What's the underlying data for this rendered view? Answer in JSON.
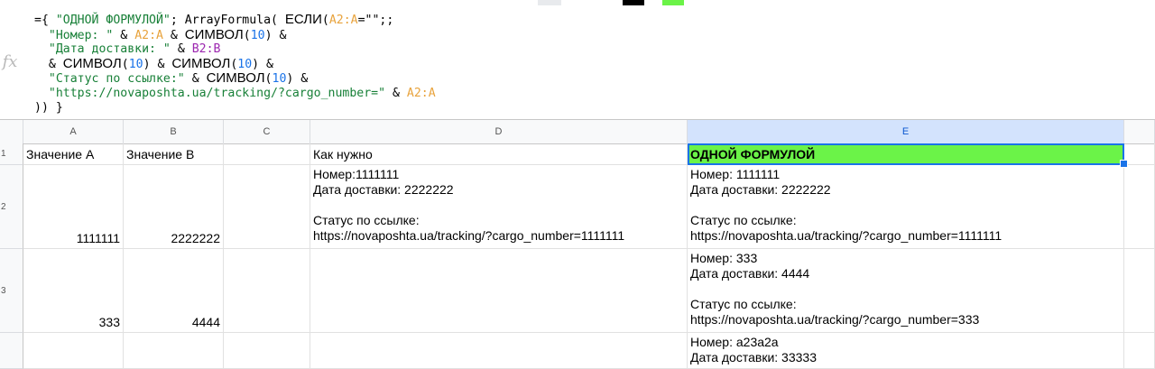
{
  "formula_bar": {
    "fx_label": "fx",
    "lines": [
      [
        {
          "t": "={ ",
          "c": "plain"
        },
        {
          "t": "\"ОДНОЙ ФОРМУЛОЙ\"",
          "c": "str"
        },
        {
          "t": "; ArrayFormula( ",
          "c": "plain"
        },
        {
          "t": "ЕСЛИ",
          "c": "fn"
        },
        {
          "t": "(",
          "c": "plain"
        },
        {
          "t": "A2:A",
          "c": "refA"
        },
        {
          "t": "=\"\";;",
          "c": "plain"
        }
      ],
      [
        {
          "t": "  ",
          "c": "plain"
        },
        {
          "t": "\"Номер: \"",
          "c": "str"
        },
        {
          "t": " & ",
          "c": "plain"
        },
        {
          "t": "A2:A",
          "c": "refA"
        },
        {
          "t": " & ",
          "c": "plain"
        },
        {
          "t": "СИМВОЛ",
          "c": "fn"
        },
        {
          "t": "(",
          "c": "plain"
        },
        {
          "t": "10",
          "c": "num"
        },
        {
          "t": ") &",
          "c": "plain"
        }
      ],
      [
        {
          "t": "  ",
          "c": "plain"
        },
        {
          "t": "\"Дата доставки: \"",
          "c": "str"
        },
        {
          "t": " & ",
          "c": "plain"
        },
        {
          "t": "B2:B",
          "c": "refB"
        }
      ],
      [
        {
          "t": "  & ",
          "c": "plain"
        },
        {
          "t": "СИМВОЛ",
          "c": "fn"
        },
        {
          "t": "(",
          "c": "plain"
        },
        {
          "t": "10",
          "c": "num"
        },
        {
          "t": ") & ",
          "c": "plain"
        },
        {
          "t": "СИМВОЛ",
          "c": "fn"
        },
        {
          "t": "(",
          "c": "plain"
        },
        {
          "t": "10",
          "c": "num"
        },
        {
          "t": ") &",
          "c": "plain"
        }
      ],
      [
        {
          "t": "  ",
          "c": "plain"
        },
        {
          "t": "\"Статус по ссылке:\"",
          "c": "str"
        },
        {
          "t": " & ",
          "c": "plain"
        },
        {
          "t": "СИМВОЛ",
          "c": "fn"
        },
        {
          "t": "(",
          "c": "plain"
        },
        {
          "t": "10",
          "c": "num"
        },
        {
          "t": ") &",
          "c": "plain"
        }
      ],
      [
        {
          "t": "  ",
          "c": "plain"
        },
        {
          "t": "\"https://novaposhta.ua/tracking/?cargo_number=\"",
          "c": "str"
        },
        {
          "t": " & ",
          "c": "plain"
        },
        {
          "t": "A2:A",
          "c": "refA"
        }
      ],
      [
        {
          "t": ")) }",
          "c": "plain"
        }
      ]
    ]
  },
  "columns": [
    "A",
    "B",
    "C",
    "D",
    "E"
  ],
  "active_column": "E",
  "rows": [
    {
      "num": "1",
      "cells": {
        "A": "Значение A",
        "B": "Значение B",
        "C": "",
        "D": "Как нужно",
        "E": "ОДНОЙ ФОРМУЛОЙ"
      }
    },
    {
      "num": "2",
      "cells": {
        "A": "1111111",
        "B": "2222222",
        "C": "",
        "D": "Номер:1111111\nДата доставки: 2222222\n\nСтатус по ссылке:\nhttps://novaposhta.ua/tracking/?cargo_number=1111111",
        "E": "Номер: 1111111\nДата доставки: 2222222\n\nСтатус по ссылке:\nhttps://novaposhta.ua/tracking/?cargo_number=1111111"
      }
    },
    {
      "num": "3",
      "cells": {
        "A": "333",
        "B": "4444",
        "C": "",
        "D": "",
        "E": "Номер: 333\nДата доставки: 4444\n\nСтатус по ссылке:\nhttps://novaposhta.ua/tracking/?cargo_number=333"
      }
    },
    {
      "num": "",
      "cells": {
        "A": "",
        "B": "",
        "C": "",
        "D": "",
        "E": "Номер: a23a2a\nДата доставки: 33333"
      }
    }
  ],
  "colors": {
    "highlight_green": "#6bf348",
    "selection_blue": "#1a73e8"
  }
}
